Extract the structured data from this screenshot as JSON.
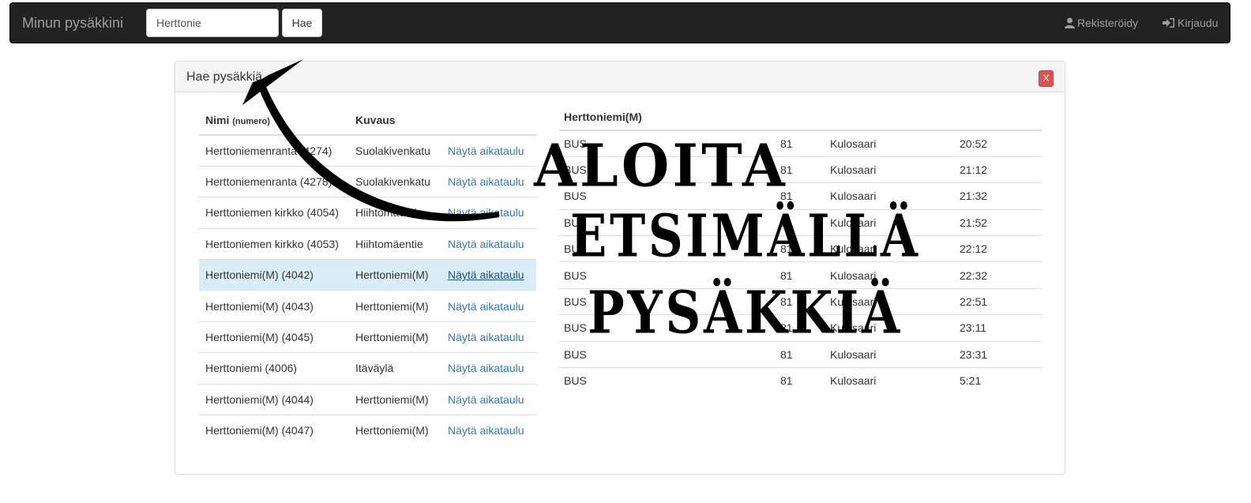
{
  "navbar": {
    "brand": "Minun pysäkkini",
    "search_value": "Herttonie",
    "search_button": "Hae",
    "register_label": "Rekisteröidy",
    "login_label": "Kirjaudu"
  },
  "panel": {
    "title": "Hae pysäkkiä",
    "close_label": "X"
  },
  "stops": {
    "headers": {
      "name": "Nimi",
      "number": "(numero)",
      "description": "Kuvaus"
    },
    "link_label": "Näytä aikataulu",
    "rows": [
      {
        "name": "Herttoniemenranta",
        "number": "(4274)",
        "description": "Suolakivenkatu",
        "link": "Näytä aikataulu"
      },
      {
        "name": "Herttoniemenranta",
        "number": "(4278)",
        "description": "Suolakivenkatu",
        "link": "Näytä aikataulu"
      },
      {
        "name": "Herttoniemen kirkko",
        "number": "(4054)",
        "description": "Hiihtomäentie",
        "link": "Näytä aikataulu"
      },
      {
        "name": "Herttoniemen kirkko",
        "number": "(4053)",
        "description": "Hiihtomäentie",
        "link": "Näytä aikataulu"
      },
      {
        "name": "Herttoniemi(M)",
        "number": "(4042)",
        "description": "Herttoniemi(M)",
        "link": "Näytä aikataulu"
      },
      {
        "name": "Herttoniemi(M)",
        "number": "(4043)",
        "description": "Herttoniemi(M)",
        "link": "Näytä aikataulu"
      },
      {
        "name": "Herttoniemi(M)",
        "number": "(4045)",
        "description": "Herttoniemi(M)",
        "link": "Näytä aikataulu"
      },
      {
        "name": "Herttoniemi",
        "number": "(4006)",
        "description": "Itäväylä",
        "link": "Näytä aikataulu"
      },
      {
        "name": "Herttoniemi(M)",
        "number": "(4044)",
        "description": "Herttoniemi(M)",
        "link": "Näytä aikataulu"
      },
      {
        "name": "Herttoniemi(M)",
        "number": "(4047)",
        "description": "Herttoniemi(M)",
        "link": "Näytä aikataulu"
      }
    ]
  },
  "schedule": {
    "title": "Herttoniemi(M)",
    "rows": [
      {
        "type": "BUS",
        "line": "81",
        "destination": "Kulosaari",
        "time": "20:52"
      },
      {
        "type": "BUS",
        "line": "81",
        "destination": "Kulosaari",
        "time": "21:12"
      },
      {
        "type": "BUS",
        "line": "81",
        "destination": "Kulosaari",
        "time": "21:32"
      },
      {
        "type": "BUS",
        "line": "81",
        "destination": "Kulosaari",
        "time": "21:52"
      },
      {
        "type": "BUS",
        "line": "81",
        "destination": "Kulosaari",
        "time": "22:12"
      },
      {
        "type": "BUS",
        "line": "81",
        "destination": "Kulosaari",
        "time": "22:32"
      },
      {
        "type": "BUS",
        "line": "81",
        "destination": "Kulosaari",
        "time": "22:51"
      },
      {
        "type": "BUS",
        "line": "81",
        "destination": "Kulosaari",
        "time": "23:11"
      },
      {
        "type": "BUS",
        "line": "81",
        "destination": "Kulosaari",
        "time": "23:31"
      },
      {
        "type": "BUS",
        "line": "81",
        "destination": "Kulosaari",
        "time": "5:21"
      }
    ]
  },
  "overlay": {
    "line1": "ALOITA",
    "line2": "ETSIMÄLLÄ",
    "line3": "PYSÄKKIÄ"
  }
}
